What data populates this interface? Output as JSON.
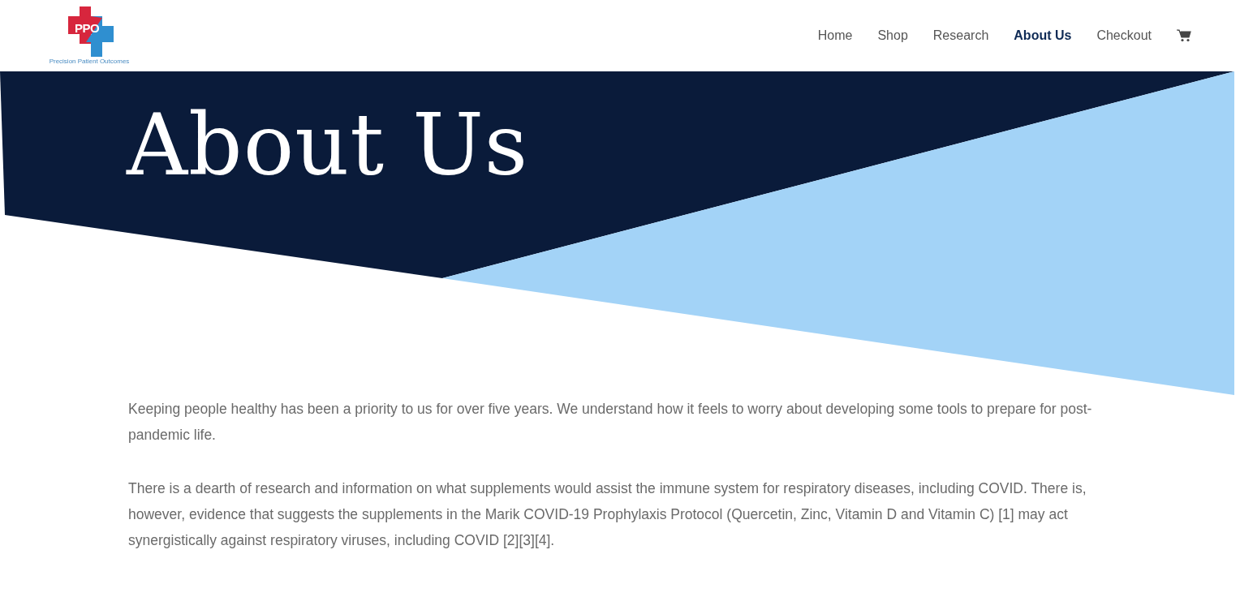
{
  "logo": {
    "mark": "PPO",
    "name": "Precision Patient Outcomes"
  },
  "nav": [
    {
      "label": "Home",
      "selected": false
    },
    {
      "label": "Shop",
      "selected": false
    },
    {
      "label": "Research",
      "selected": false
    },
    {
      "label": "About Us",
      "selected": true
    },
    {
      "label": "Checkout",
      "selected": false
    }
  ],
  "hero": {
    "title": "About Us"
  },
  "paragraphs": [
    "Keeping people healthy has been a priority to us for over five years.  We understand how it feels to worry about developing some tools to prepare for post-pandemic life.",
    "There is a dearth of research and information on what supplements would assist the immune system for respiratory diseases, including COVID.  There is, however, evidence that suggests the supplements in the Marik COVID-19 Prophylaxis Protocol (Quercetin, Zinc, Vitamin D and Vitamin C) [1] may act synergistically against respiratory viruses, including COVID [2][3][4]."
  ]
}
